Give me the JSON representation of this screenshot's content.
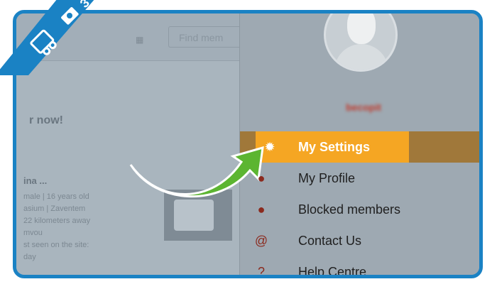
{
  "badge": {
    "count": "3"
  },
  "left": {
    "search_placeholder": "Find mem",
    "join_text": "r now!",
    "member_name": "ina ...",
    "member_lines": [
      "male | 16 years old",
      "asium | Zaventem",
      "22 kilometers away",
      "mvou",
      "st seen on the site:",
      "day"
    ]
  },
  "profile": {
    "username": "becopit"
  },
  "menu": {
    "items": [
      {
        "label": "My Settings",
        "icon": "gear-icon",
        "glyph": "✹"
      },
      {
        "label": "My Profile",
        "icon": "person-icon",
        "glyph": "●"
      },
      {
        "label": "Blocked members",
        "icon": "blocked-person-icon",
        "glyph": "●"
      },
      {
        "label": "Contact Us",
        "icon": "at-icon",
        "glyph": "@"
      },
      {
        "label": "Help Centre",
        "icon": "help-icon",
        "glyph": "?"
      }
    ]
  },
  "colors": {
    "accent": "#f5a623",
    "frame": "#1a82c4",
    "arrow": "#5cb531"
  }
}
